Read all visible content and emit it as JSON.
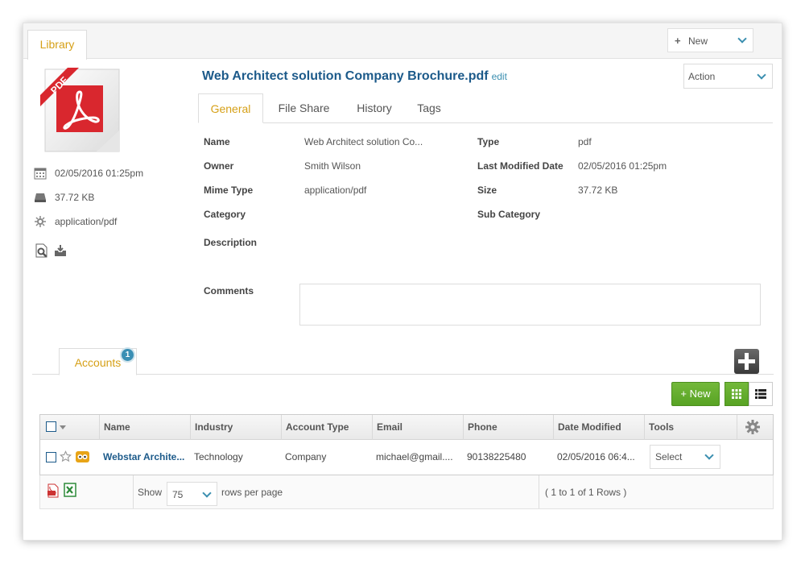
{
  "library_tab": "Library",
  "top_new": "New",
  "document": {
    "title": "Web Architect solution Company Brochure.pdf",
    "edit_link": "edit",
    "pdf_ribbon": "PDF"
  },
  "action_label": "Action",
  "sidebar": {
    "date": "02/05/2016 01:25pm",
    "size": "37.72 KB",
    "mime": "application/pdf"
  },
  "tabs": [
    "General",
    "File Share",
    "History",
    "Tags"
  ],
  "general": {
    "name_label": "Name",
    "name_value": "Web Architect solution Co...",
    "type_label": "Type",
    "type_value": "pdf",
    "owner_label": "Owner",
    "owner_value": "Smith Wilson",
    "modified_label": "Last Modified Date",
    "modified_value": "02/05/2016 01:25pm",
    "mime_label": "Mime Type",
    "mime_value": "application/pdf",
    "size_label": "Size",
    "size_value": "37.72 KB",
    "category_label": "Category",
    "subcategory_label": "Sub Category",
    "description_label": "Description",
    "comments_label": "Comments"
  },
  "accounts": {
    "tab_label": "Accounts",
    "badge": "1",
    "new_button": "+ New",
    "columns": [
      "Name",
      "Industry",
      "Account Type",
      "Email",
      "Phone",
      "Date Modified",
      "Tools"
    ],
    "rows": [
      {
        "name": "Webstar Archite...",
        "industry": "Technology",
        "account_type": "Company",
        "email": "michael@gmail....",
        "phone": "90138225480",
        "date_modified": "02/05/2016 06:4...",
        "tools": "Select"
      }
    ],
    "footer": {
      "show": "Show",
      "rows_per_page_value": "75",
      "rows_per_page": "rows per page",
      "summary": "( 1 to 1 of 1 Rows )"
    }
  },
  "colors": {
    "accent_tab": "#d6a017",
    "title_blue": "#1c5a8a",
    "link_blue": "#3b8fb0",
    "green_button": "#58a324",
    "pdf_red": "#d9272e"
  }
}
